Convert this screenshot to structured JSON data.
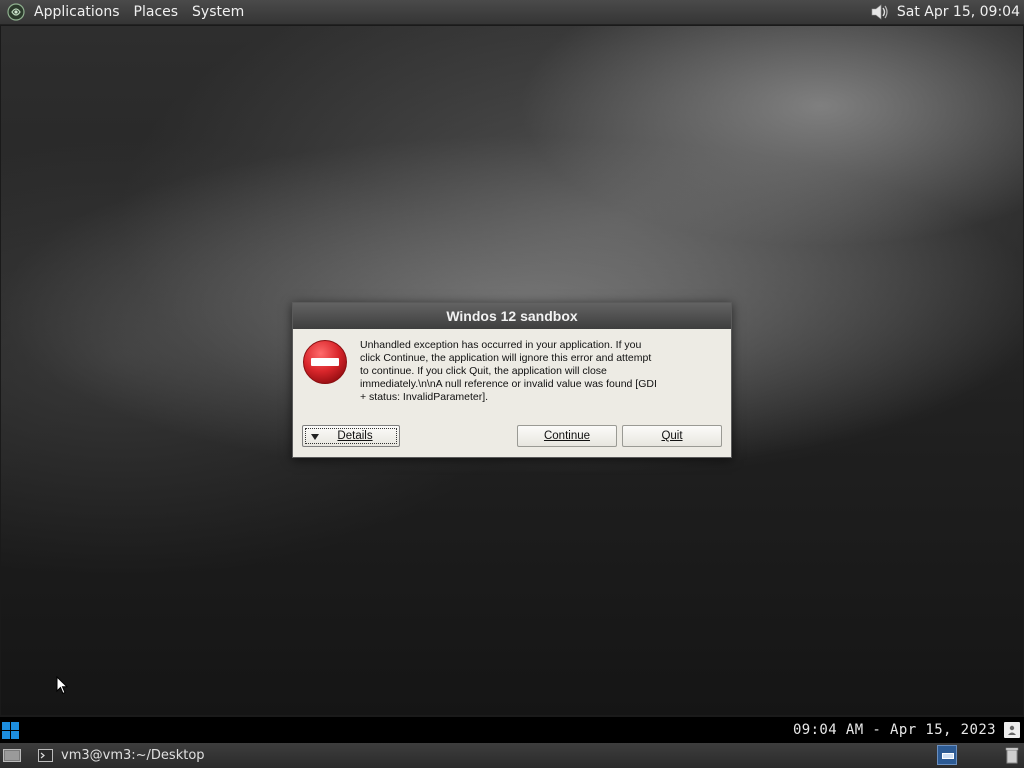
{
  "top_panel": {
    "menus": [
      "Applications",
      "Places",
      "System"
    ],
    "clock": "Sat Apr 15, 09:04"
  },
  "dialog": {
    "title": "Windos 12 sandbox",
    "message": "Unhandled exception has occurred in your application. If you click Continue, the application will ignore this error and attempt to continue. If you click Quit, the application will close immediately.\\n\\nA null reference or invalid value was found [GDI + status: InvalidParameter].",
    "message_lines": [
      "Unhandled exception has occurred in your application. If you",
      "click Continue, the application will ignore this error and attempt",
      "to continue. If you click Quit, the application will close",
      "immediately.\\n\\nA null reference or invalid value was found [GDI",
      "+ status: InvalidParameter]."
    ],
    "details_label": "Details",
    "continue_label": "Continue",
    "quit_label": "Quit"
  },
  "time_bar": {
    "clock": "09:04 AM - Apr 15, 2023"
  },
  "taskbar": {
    "task_label": "vm3@vm3:~/Desktop"
  },
  "colors": {
    "dialog_bg": "#edebe4",
    "title_bar": "#4e4e4e",
    "error_red": "#d9262b",
    "panel": "#3c3c3c"
  }
}
